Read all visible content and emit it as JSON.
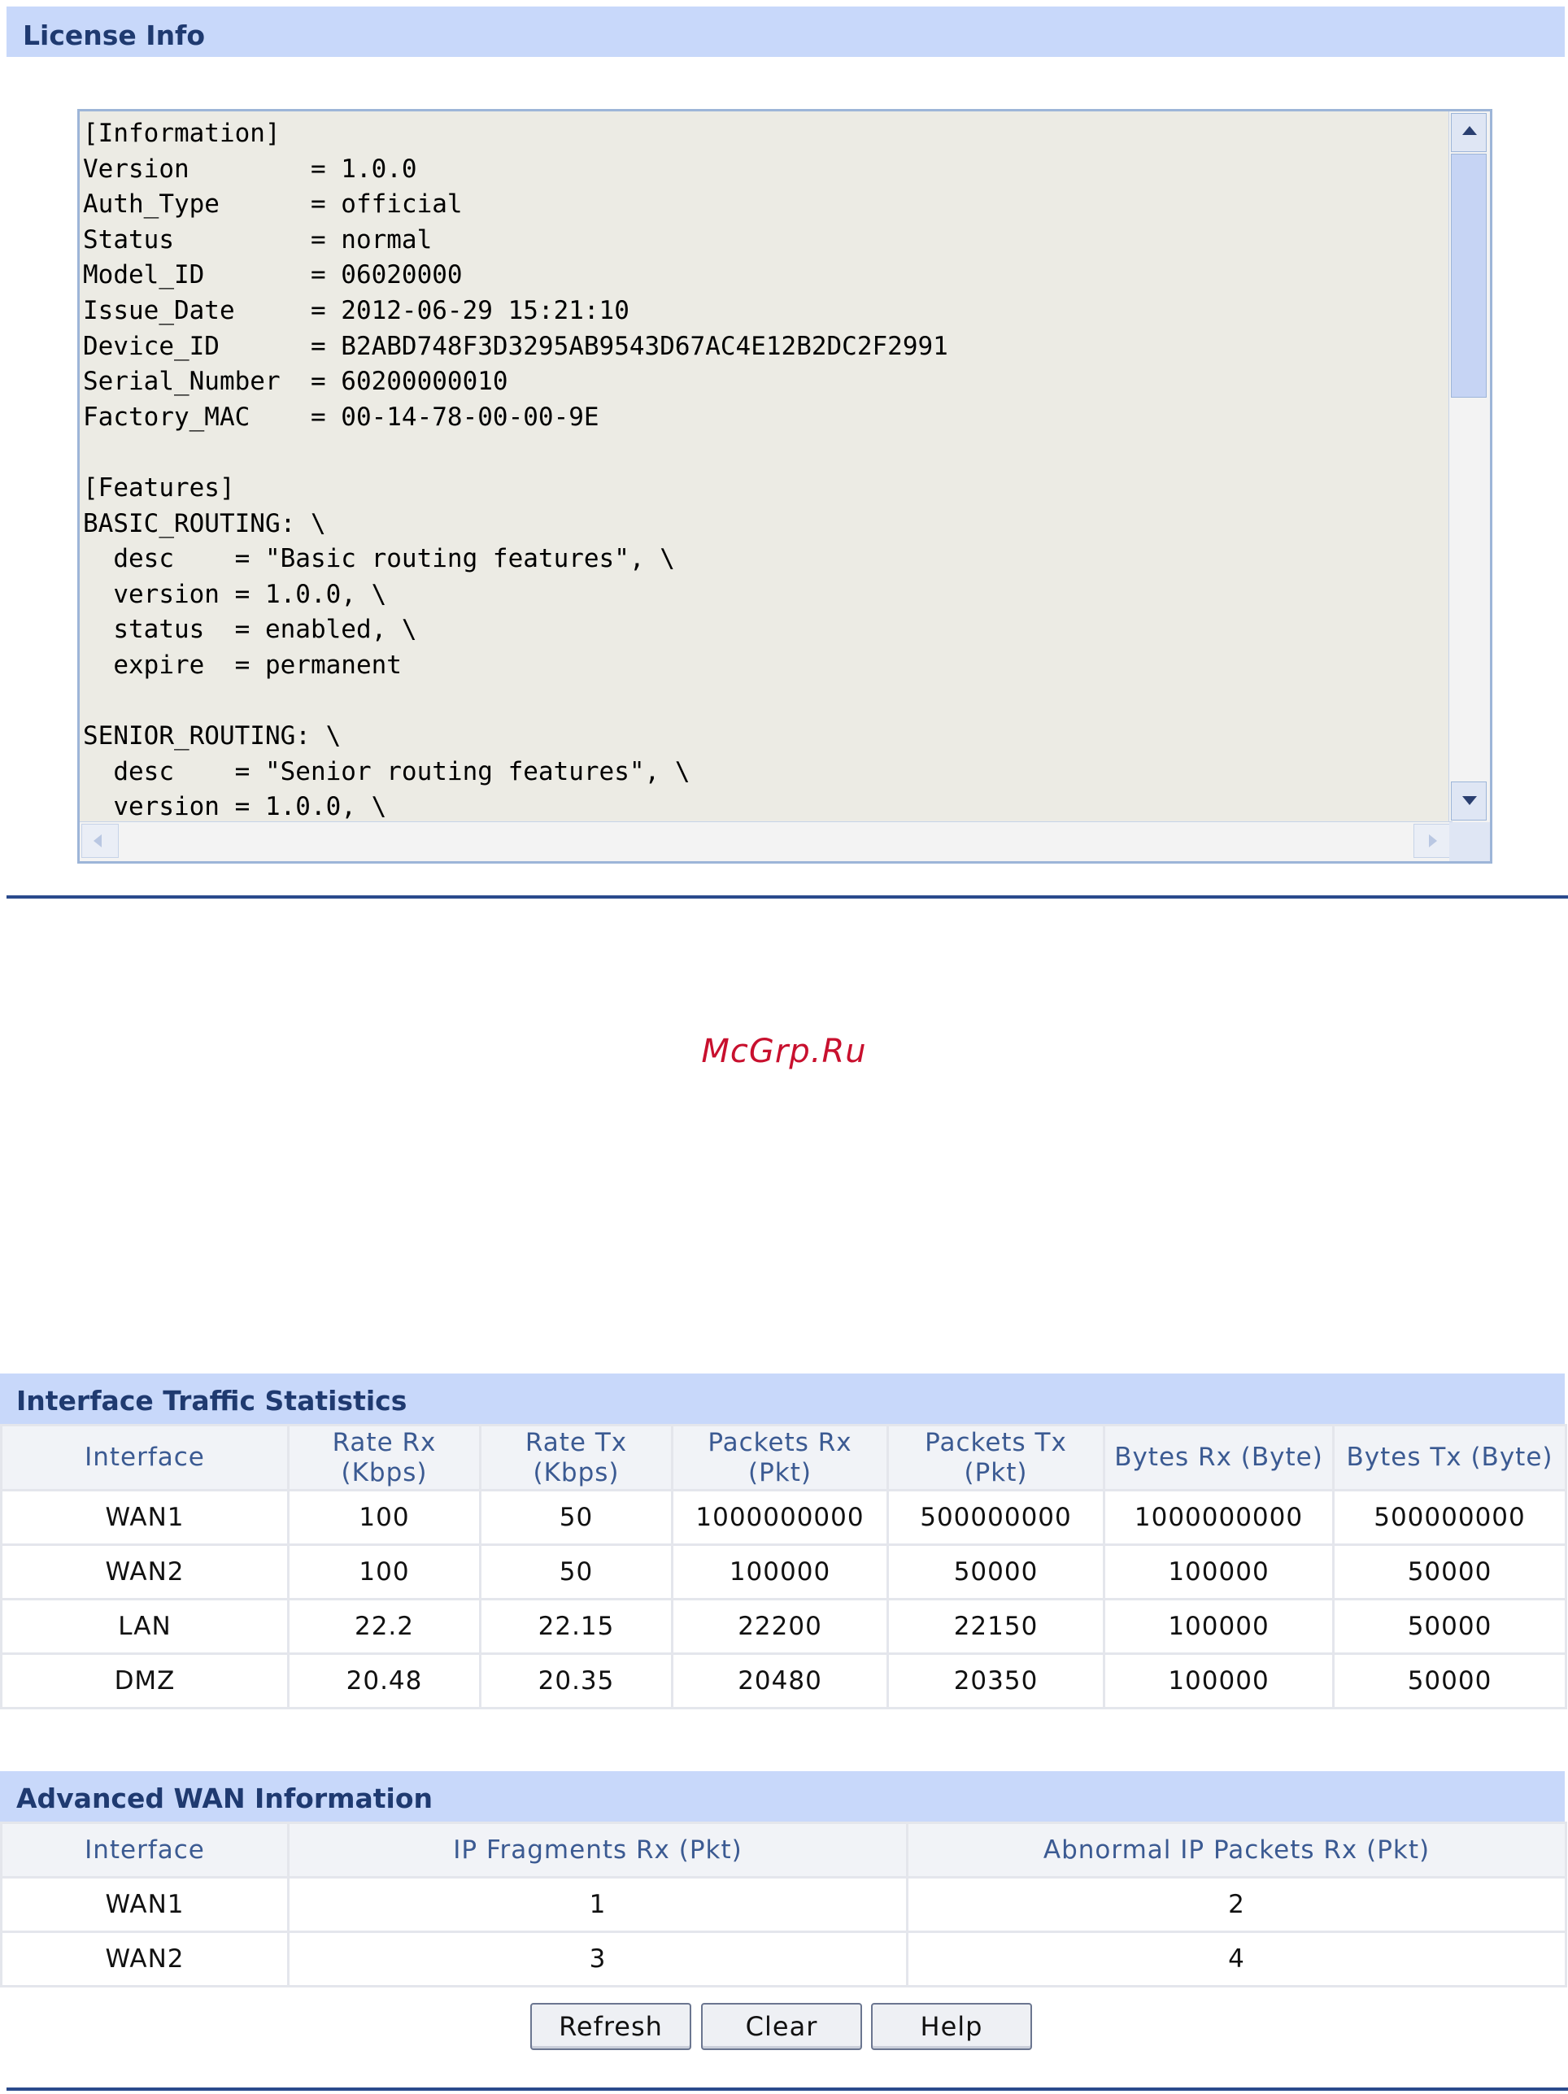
{
  "license": {
    "title": "License Info",
    "lines": [
      "[Information]",
      "Version        = 1.0.0",
      "Auth_Type      = official",
      "Status         = normal",
      "Model_ID       = 06020000",
      "Issue_Date     = 2012-06-29 15:21:10",
      "Device_ID      = B2ABD748F3D3295AB9543D67AC4E12B2DC2F2991",
      "Serial_Number  = 60200000010",
      "Factory_MAC    = 00-14-78-00-00-9E",
      "",
      "[Features]",
      "BASIC_ROUTING: \\",
      "  desc    = \"Basic routing features\", \\",
      "  version = 1.0.0, \\",
      "  status  = enabled, \\",
      "  expire  = permanent",
      "",
      "SENIOR_ROUTING: \\",
      "  desc    = \"Senior routing features\", \\",
      "  version = 1.0.0, \\"
    ]
  },
  "watermark": "McGrp.Ru",
  "traffic": {
    "title": "Interface Traffic Statistics",
    "headers": [
      "Interface",
      "Rate Rx\n(Kbps)",
      "Rate Tx\n(Kbps)",
      "Packets Rx\n(Pkt)",
      "Packets Tx\n(Pkt)",
      "Bytes Rx (Byte)",
      "Bytes Tx (Byte)"
    ],
    "rows": [
      [
        "WAN1",
        "100",
        "50",
        "1000000000",
        "500000000",
        "1000000000",
        "500000000"
      ],
      [
        "WAN2",
        "100",
        "50",
        "100000",
        "50000",
        "100000",
        "50000"
      ],
      [
        "LAN",
        "22.2",
        "22.15",
        "22200",
        "22150",
        "100000",
        "50000"
      ],
      [
        "DMZ",
        "20.48",
        "20.35",
        "20480",
        "20350",
        "100000",
        "50000"
      ]
    ]
  },
  "advanced": {
    "title": "Advanced WAN Information",
    "headers": [
      "Interface",
      "IP Fragments Rx (Pkt)",
      "Abnormal IP Packets Rx (Pkt)"
    ],
    "rows": [
      [
        "WAN1",
        "1",
        "2"
      ],
      [
        "WAN2",
        "3",
        "4"
      ]
    ]
  },
  "buttons": {
    "refresh": "Refresh",
    "clear": "Clear",
    "help": "Help"
  },
  "colors": {
    "header_bg": "#c8d8fa",
    "header_text": "#1f3a70",
    "rule": "#2a4a8c",
    "watermark": "#c8102e"
  }
}
